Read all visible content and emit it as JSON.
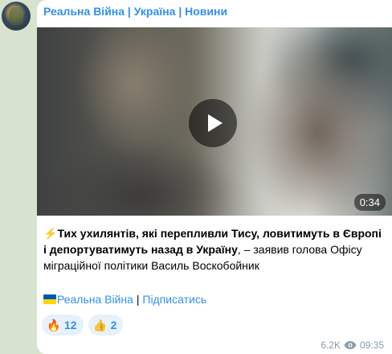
{
  "channel": {
    "name": "Реальна Війна | Україна | Новини"
  },
  "video": {
    "duration": "0:34"
  },
  "message": {
    "lead_emoji": "⚡",
    "bold_text": "Тих ухилянтів, які перепливли Тису, ловитимуть в Європі і депортуватимуть назад в Україну",
    "rest_text": ", – заявив голова Офісу міграційної політики Василь Воскобойник"
  },
  "footer": {
    "channel_link": "Реальна Війна",
    "separator": " | ",
    "subscribe_link": "Підписатись"
  },
  "reactions": [
    {
      "icon": "fire-icon",
      "emoji": "🔥",
      "count": "12"
    },
    {
      "icon": "thumbs-up-icon",
      "emoji": "👍",
      "count": "2"
    }
  ],
  "meta": {
    "views": "6.2K",
    "time": "09:35"
  },
  "colors": {
    "accent": "#3390ec",
    "background": "#d7e3cf"
  }
}
